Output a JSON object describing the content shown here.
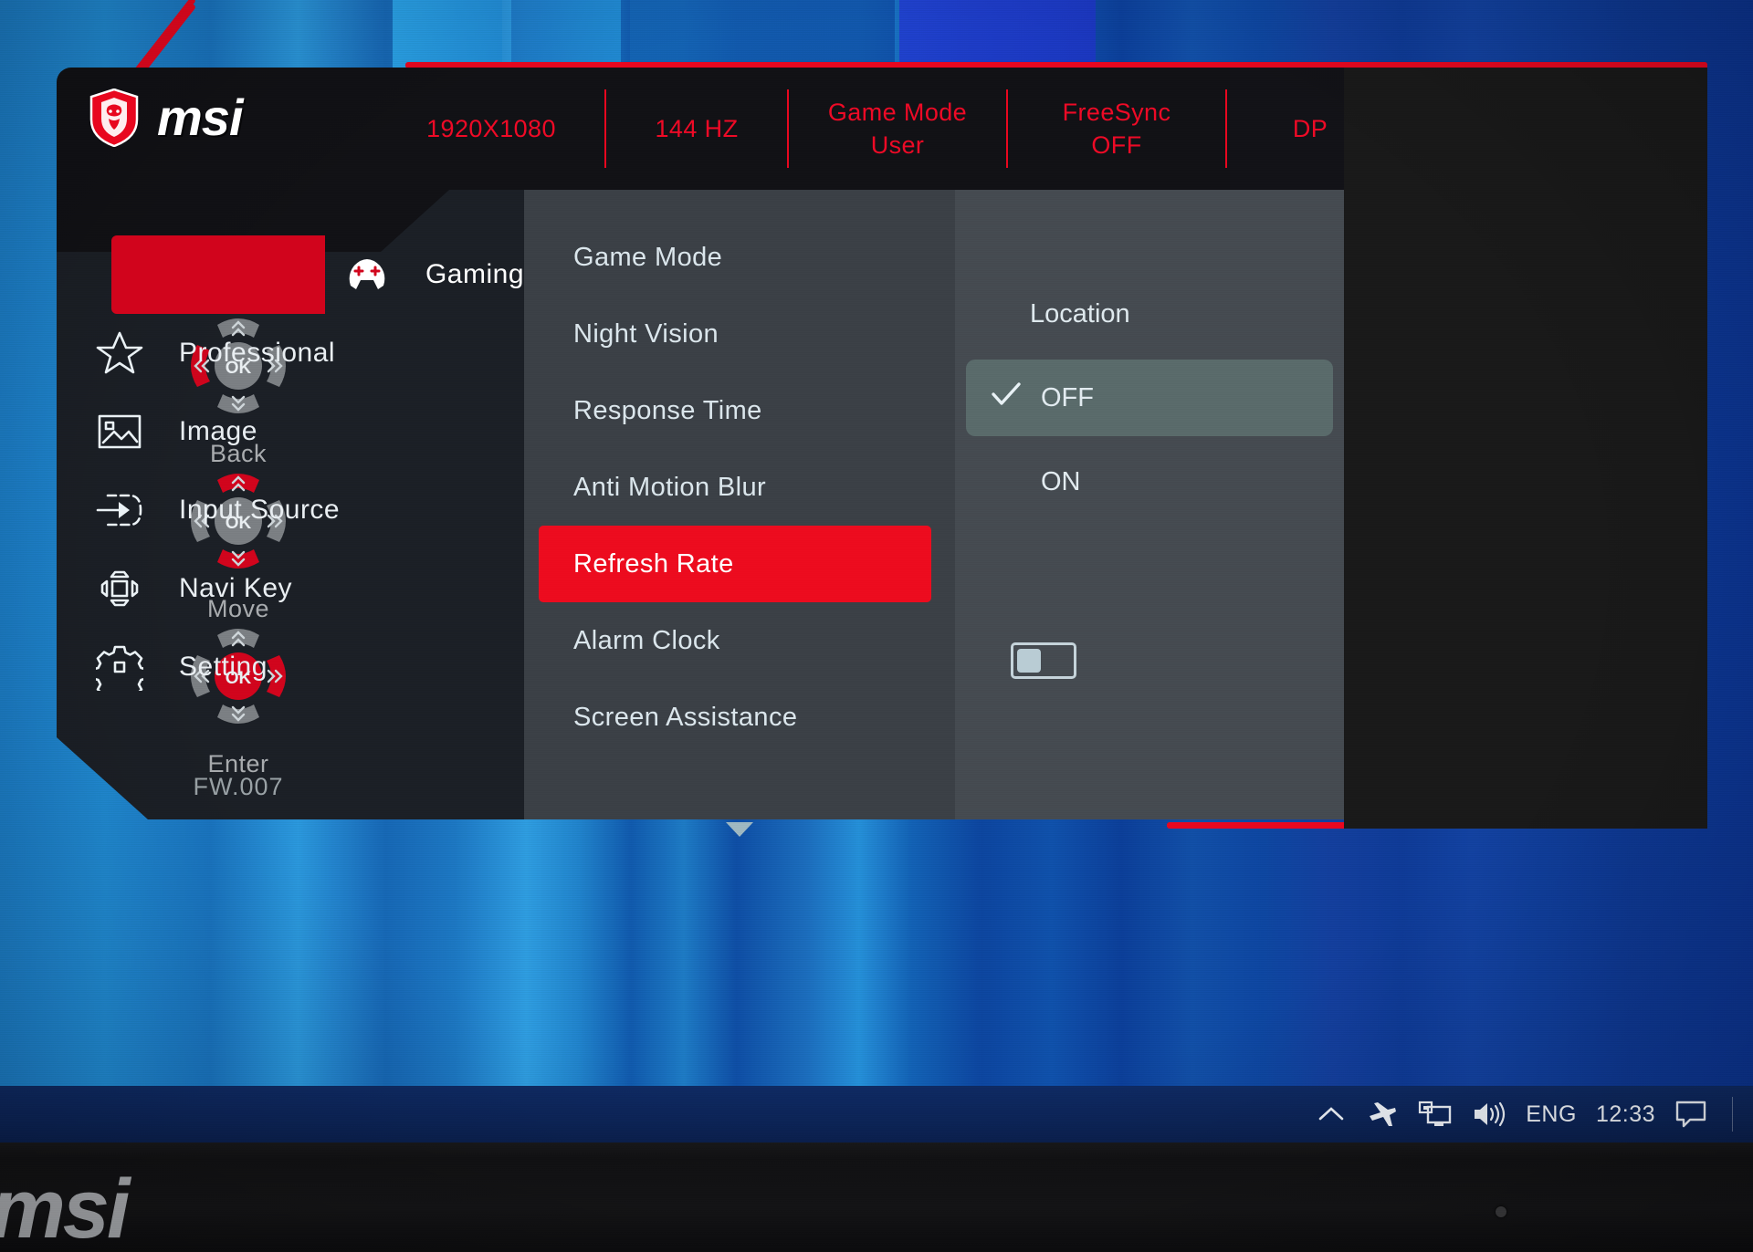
{
  "osd": {
    "brand": "msi",
    "brand_logo_icon": "msi-dragon-shield-icon",
    "status": [
      {
        "line1": "1920X1080",
        "line2": ""
      },
      {
        "line1": "144 HZ",
        "line2": ""
      },
      {
        "line1": "Game Mode",
        "line2": "User"
      },
      {
        "line1": "FreeSync",
        "line2": "OFF"
      },
      {
        "line1": "DP",
        "line2": ""
      }
    ],
    "sidebar": [
      {
        "label": "Gaming",
        "icon": "gamepad-icon",
        "active": true
      },
      {
        "label": "Professional",
        "icon": "star-icon",
        "active": false
      },
      {
        "label": "Image",
        "icon": "picture-icon",
        "active": false
      },
      {
        "label": "Input Source",
        "icon": "input-arrow-icon",
        "active": false
      },
      {
        "label": "Navi Key",
        "icon": "navi-key-icon",
        "active": false
      },
      {
        "label": "Setting",
        "icon": "gear-icon",
        "active": false
      }
    ],
    "menu": [
      {
        "label": "Game Mode",
        "selected": false,
        "toggle": null
      },
      {
        "label": "Night Vision",
        "selected": false,
        "toggle": null
      },
      {
        "label": "Response Time",
        "selected": false,
        "toggle": null
      },
      {
        "label": "Anti Motion Blur",
        "selected": false,
        "toggle": "off"
      },
      {
        "label": "Refresh Rate",
        "selected": true,
        "toggle": null
      },
      {
        "label": "Alarm Clock",
        "selected": false,
        "toggle": null
      },
      {
        "label": "Screen Assistance",
        "selected": false,
        "toggle": null
      }
    ],
    "menu_scroll_icon": "chevron-down-icon",
    "options": {
      "title": "Location",
      "items": [
        {
          "label": "OFF",
          "checked": true
        },
        {
          "label": "ON",
          "checked": false
        }
      ],
      "check_icon": "checkmark-icon"
    },
    "navkeys": [
      {
        "label": "Back",
        "highlight": "left",
        "ok_highlight": false
      },
      {
        "label": "Move",
        "highlight": "updown",
        "ok_highlight": false
      },
      {
        "label": "Enter",
        "highlight": "right",
        "ok_highlight": true
      }
    ],
    "ok_label": "OK",
    "firmware": "FW.007",
    "colors": {
      "accent_red": "#ed0b1e",
      "frame_red": "#e8071f",
      "panel_dark": "#1b1f26",
      "panel_mid": "#3b4046",
      "panel_right": "#454b51",
      "text_light": "#dbe6ec"
    }
  },
  "taskbar": {
    "items": [
      {
        "icon": "chevron-up-icon",
        "label": ""
      },
      {
        "icon": "airplane-icon",
        "label": ""
      },
      {
        "icon": "network-pc-icon",
        "label": ""
      },
      {
        "icon": "speaker-icon",
        "label": ""
      }
    ],
    "language": "ENG",
    "clock": "12:33",
    "action_center_icon": "speech-bubble-icon"
  },
  "monitor": {
    "bezel_brand": "msi"
  }
}
